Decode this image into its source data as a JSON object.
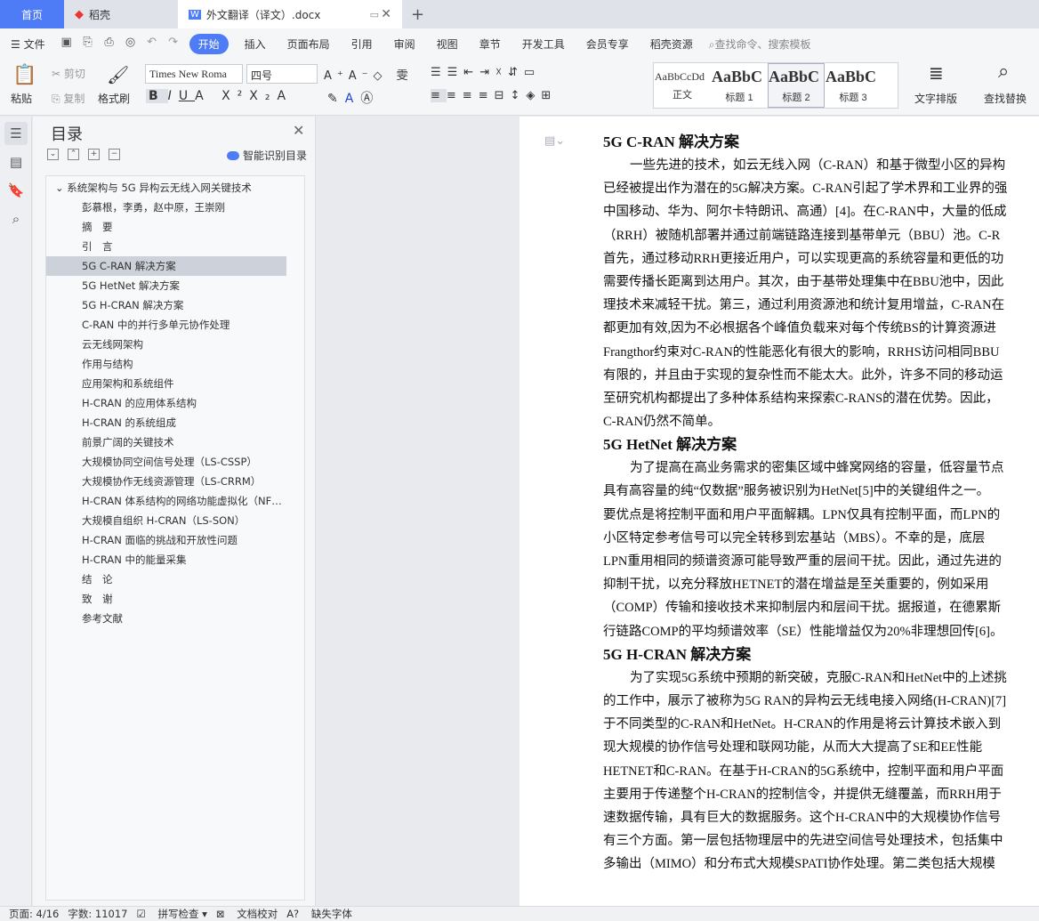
{
  "tabs": {
    "home": "首页",
    "daoke": "稻壳",
    "doc": "外文翻译（译文）.docx"
  },
  "menu": {
    "file": "文件",
    "items": [
      "开始",
      "插入",
      "页面布局",
      "引用",
      "审阅",
      "视图",
      "章节",
      "开发工具",
      "会员专享",
      "稻壳资源"
    ],
    "search": "查找命令、搜索模板"
  },
  "ribbon": {
    "paste": "粘贴",
    "cut": "剪切",
    "copy": "复制",
    "format_painter": "格式刷",
    "font": "Times New Roma",
    "size": "四号",
    "text_layout": "文字排版",
    "find_replace": "查找替换"
  },
  "styles": [
    {
      "preview": "AaBbCcDd",
      "label": "正文"
    },
    {
      "preview": "AaBbC",
      "label": "标题 1"
    },
    {
      "preview": "AaBbC",
      "label": "标题 2"
    },
    {
      "preview": "AaBbC",
      "label": "标题 3"
    }
  ],
  "toc": {
    "title": "目录",
    "smart": "智能识别目录",
    "items": [
      "系统架构与 5G 异构云无线入网关键技术",
      "彭慕根，李勇，赵中原，王崇刚",
      "摘　要",
      "引　言",
      "5G C-RAN 解决方案",
      "5G HetNet 解决方案",
      "5G H-CRAN 解决方案",
      "C-RAN 中的并行多单元协作处理",
      "云无线网架构",
      "作用与结构",
      "应用架构和系统组件",
      "H-CRAN 的应用体系结构",
      "H-CRAN 的系统组成",
      "前景广阔的关键技术",
      "大规模协同空间信号处理（LS-CSSP）",
      "大规模协作无线资源管理（LS-CRRM）",
      "H-CRAN 体系结构的网络功能虚拟化（NFV）",
      "大规模自组织 H-CRAN（LS-SON）",
      "H-CRAN 面临的挑战和开放性问题",
      "H-CRAN 中的能量采集",
      "结　论",
      "致　谢",
      "参考文献"
    ]
  },
  "doc": {
    "lines": [
      {
        "t": "h",
        "v": "5G C-RAN 解决方案"
      },
      {
        "t": "i",
        "v": "一些先进的技术，如云无线入网（C-RAN）和基于微型小区的异构"
      },
      {
        "t": "p",
        "v": "已经被提出作为潜在的5G解决方案。C-RAN引起了学术界和工业界的强"
      },
      {
        "t": "p",
        "v": "中国移动、华为、阿尔卡特朗讯、高通）[4]。在C-RAN中，大量的低成"
      },
      {
        "t": "p",
        "v": "（RRH）被随机部署并通过前端链路连接到基带单元（BBU）池。C-R"
      },
      {
        "t": "p",
        "v": "首先，通过移动RRH更接近用户，可以实现更高的系统容量和更低的功"
      },
      {
        "t": "p",
        "v": "需要传播长距离到达用户。其次，由于基带处理集中在BBU池中，因此"
      },
      {
        "t": "p",
        "v": "理技术来减轻干扰。第三，通过利用资源池和统计复用增益，C-RAN在"
      },
      {
        "t": "p",
        "v": "都更加有效,因为不必根据各个峰值负载来对每个传统BS的计算资源进"
      },
      {
        "t": "p",
        "v": "Frangthor约束对C-RAN的性能恶化有很大的影响，RRHS访问相同BBU"
      },
      {
        "t": "p",
        "v": "有限的，并且由于实现的复杂性而不能太大。此外，许多不同的移动运"
      },
      {
        "t": "p",
        "v": "至研究机构都提出了多种体系结构来探索C-RANS的潜在优势。因此，"
      },
      {
        "t": "p",
        "v": "C-RAN仍然不简单。"
      },
      {
        "t": "h",
        "v": "5G HetNet 解决方案"
      },
      {
        "t": "i",
        "v": "为了提高在高业务需求的密集区域中蜂窝网络的容量，低容量节点"
      },
      {
        "t": "p",
        "v": "具有高容量的纯“仅数据”服务被识别为HetNet[5]中的关键组件之一。"
      },
      {
        "t": "p",
        "v": "要优点是将控制平面和用户平面解耦。LPN仅具有控制平面，而LPN的"
      },
      {
        "t": "p",
        "v": "小区特定参考信号可以完全转移到宏基站（MBS）。不幸的是，底层"
      },
      {
        "t": "p",
        "v": "LPN重用相同的频谱资源可能导致严重的层间干扰。因此，通过先进的"
      },
      {
        "t": "p",
        "v": "抑制干扰，以充分释放HETNET的潜在增益是至关重要的，例如采用"
      },
      {
        "t": "p",
        "v": "（COMP）传输和接收技术来抑制层内和层间干扰。据报道，在德累斯"
      },
      {
        "t": "p",
        "v": "行链路COMP的平均频谱效率（SE）性能增益仅为20%非理想回传[6]。"
      },
      {
        "t": "h",
        "v": "5G H-CRAN 解决方案"
      },
      {
        "t": "i",
        "v": "为了实现5G系统中预期的新突破，克服C-RAN和HetNet中的上述挑"
      },
      {
        "t": "p",
        "v": "的工作中，展示了被称为5G RAN的异构云无线电接入网络(H-CRAN)[7]"
      },
      {
        "t": "p",
        "v": "于不同类型的C-RAN和HetNet。H-CRAN的作用是将云计算技术嵌入到"
      },
      {
        "t": "p",
        "v": "现大规模的协作信号处理和联网功能，从而大大提高了SE和EE性能"
      },
      {
        "t": "p",
        "v": "HETNET和C-RAN。在基于H-CRAN的5G系统中，控制平面和用户平面"
      },
      {
        "t": "p",
        "v": "主要用于传递整个H-CRAN的控制信令，并提供无缝覆盖，而RRH用于"
      },
      {
        "t": "p",
        "v": "速数据传输，具有巨大的数据服务。这个H-CRAN中的大规模协作信号"
      },
      {
        "t": "p",
        "v": "有三个方面。第一层包括物理层中的先进空间信号处理技术，包括集中"
      },
      {
        "t": "p",
        "v": "多输出（MIMO）和分布式大规模SPATI协作处理。第二类包括大规模"
      }
    ]
  },
  "status": {
    "page": "页面: 4/16",
    "words": "字数: 11017",
    "spell": "拼写检查",
    "proof": "文档校对",
    "missing_font": "缺失字体"
  }
}
